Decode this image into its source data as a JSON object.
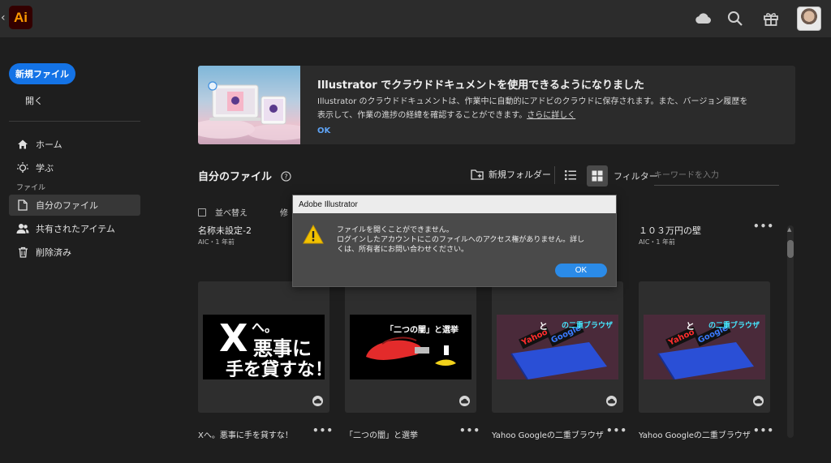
{
  "app": {
    "logo_text": "Ai",
    "accent": "#1473e6",
    "logo_bg": "#330000",
    "logo_fg": "#ff9a00"
  },
  "topbar": {
    "icons": [
      "cloud-icon",
      "search-icon",
      "gift-icon"
    ]
  },
  "sidebar": {
    "new_file_label": "新規ファイル",
    "open_label": "開く",
    "items": [
      {
        "label": "ホーム",
        "icon": "home-icon"
      },
      {
        "label": "学ぶ",
        "icon": "lightbulb-icon"
      }
    ],
    "section_label": "ファイル",
    "file_items": [
      {
        "label": "自分のファイル",
        "icon": "document-icon",
        "active": true
      },
      {
        "label": "共有されたアイテム",
        "icon": "people-icon"
      },
      {
        "label": "削除済み",
        "icon": "trash-icon"
      }
    ]
  },
  "banner": {
    "title": "Illustrator でクラウドドキュメントを使用できるようになりました",
    "body_line1": "Illustrator のクラウドドキュメントは、作業中に自動的にアドビのクラウドに保存されます。また、バージョン履歴を",
    "body_line2": "表示して、作業の進捗の経緯を確認することができます。",
    "more_link": "さらに詳しく",
    "ok_label": "OK"
  },
  "files": {
    "title": "自分のファイル",
    "new_folder_label": "新規フォルダー",
    "filter_label": "フィルター",
    "search_placeholder": "キーワードを入力",
    "sort_label": "並べ替え",
    "modified_label": "修",
    "row1": [
      {
        "name": "名称未設定-2",
        "meta": "AIC・1 年前"
      },
      {
        "name": "１０３万円の壁",
        "meta": "AIC・1 年前"
      }
    ],
    "more_label": "•••",
    "cards": [
      {
        "name": "Xへ。悪事に手を貸すな！",
        "thumb_line1": "へ。",
        "thumb_line2": "悪事に",
        "thumb_line3": "手を貸すな！",
        "thumb_x": "X"
      },
      {
        "name": "「二つの闇」と選挙",
        "thumb_title": "「二つの闇」と選挙"
      },
      {
        "name": "Yahoo Googleの二重ブラウザ",
        "thumb_title": "の二重ブラウザ",
        "thumb_to": "と",
        "thumb_yahoo": "Yahoo",
        "thumb_google": "Google"
      },
      {
        "name": "Yahoo Googleの二重ブラウザ",
        "thumb_title": "の二重ブラウザ",
        "thumb_to": "と",
        "thumb_yahoo": "Yahoo",
        "thumb_google": "Google"
      }
    ]
  },
  "dialog": {
    "title": "Adobe Illustrator",
    "line1": "ファイルを開くことができません。",
    "line2": "ログインしたアカウントにこのファイルへのアクセス権がありません。詳し",
    "line3": "くは、所有者にお問い合わせください。",
    "ok_label": "OK"
  }
}
